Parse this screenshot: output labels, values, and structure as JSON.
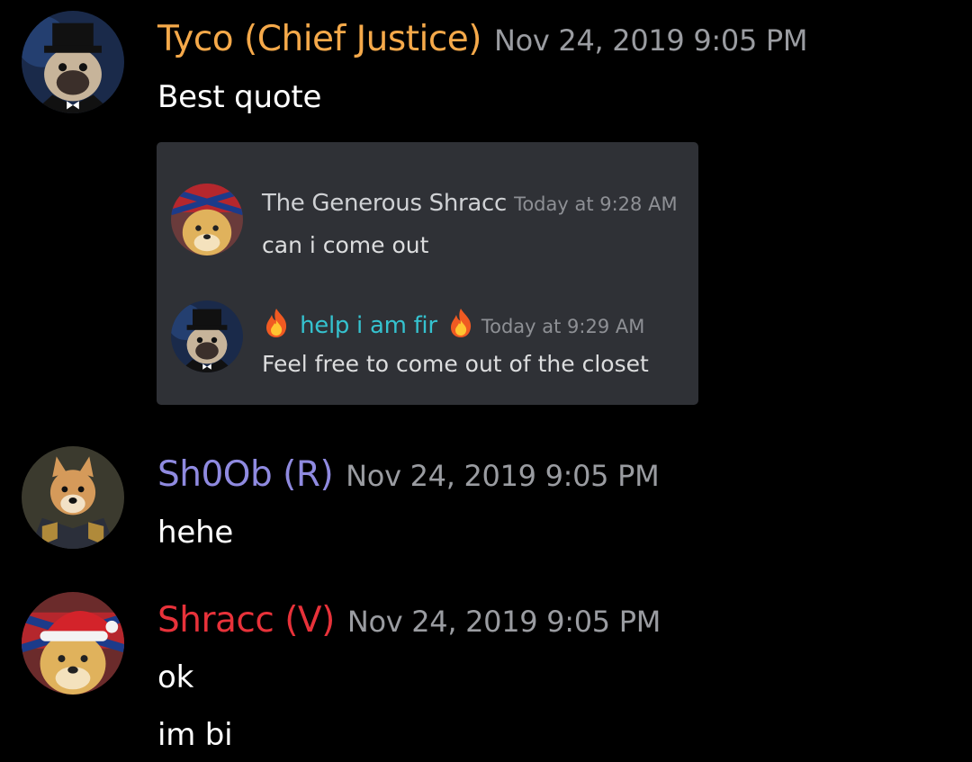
{
  "messages": [
    {
      "username": "Tyco (Chief Justice)",
      "username_color": "#f5a94a",
      "timestamp": "Nov 24, 2019 9:05 PM",
      "lines": [
        "Best quote"
      ],
      "avatar": "pug-top-hat-avatar"
    },
    {
      "username": "Sh0Ob (R)",
      "username_color": "#8f8ae0",
      "timestamp": "Nov 24, 2019 9:05 PM",
      "lines": [
        "hehe"
      ],
      "avatar": "shiba-uniform-avatar"
    },
    {
      "username": "Shracc (V)",
      "username_color": "#e8323a",
      "timestamp": "Nov 24, 2019 9:05 PM",
      "lines": [
        "ok",
        "im bi"
      ],
      "avatar": "doge-santa-hat-avatar"
    }
  ],
  "quote": {
    "messages": [
      {
        "username": "The Generous Shracc",
        "timestamp": "Today at 9:28 AM",
        "text": "can i come out",
        "avatar": "doge-bandana-avatar"
      },
      {
        "username": "help i am fir",
        "username_color": "#35c2cf",
        "timestamp": "Today at 9:29 AM",
        "text": "Feel free to come out of the closet",
        "avatar": "pug-top-hat-avatar",
        "icons": [
          "fire-icon",
          "fire-icon"
        ]
      }
    ]
  },
  "colors": {
    "background": "#000000",
    "quote_card": "#2f3136",
    "timestamp": "#9a9ca1"
  }
}
